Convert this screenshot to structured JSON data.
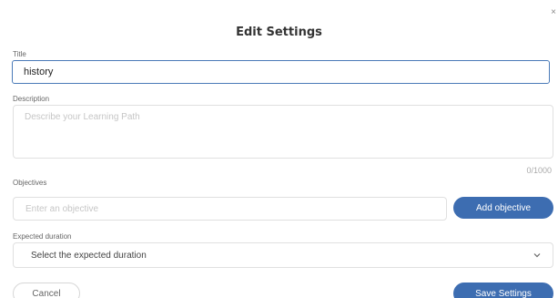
{
  "dialog": {
    "title": "Edit Settings",
    "close_icon": "close-icon"
  },
  "title_field": {
    "label": "Title",
    "value": "history"
  },
  "description_field": {
    "label": "Description",
    "placeholder": "Describe your Learning Path",
    "value": "",
    "char_count": "0/1000"
  },
  "objectives_field": {
    "label": "Objectives",
    "placeholder": "Enter an objective",
    "add_button_label": "Add objective"
  },
  "duration_field": {
    "label": "Expected duration",
    "selected": "Select the expected duration"
  },
  "footer": {
    "cancel_label": "Cancel",
    "save_label": "Save Settings"
  },
  "colors": {
    "primary": "#3d6db1",
    "focus_border": "#4a7ab8"
  }
}
